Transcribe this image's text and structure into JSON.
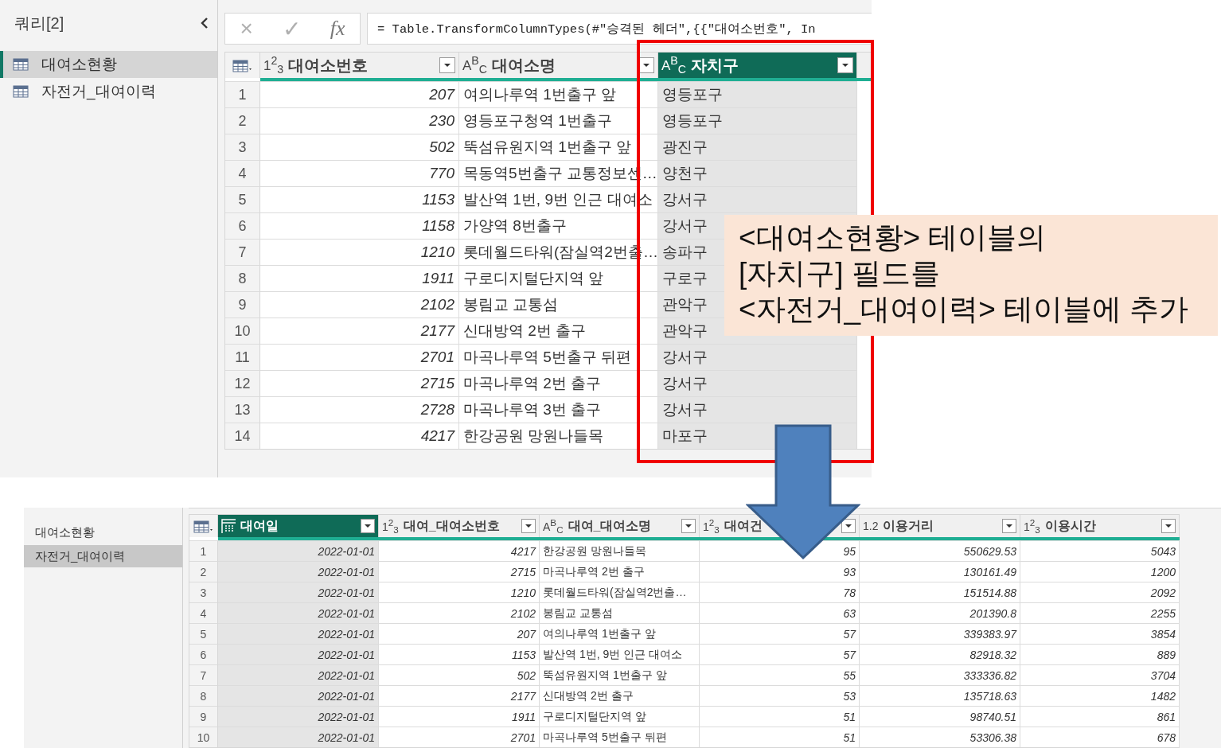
{
  "top_panel": {
    "sidebar": {
      "title": "쿼리[2]",
      "items": [
        {
          "label": "대여소현황",
          "selected": true
        },
        {
          "label": "자전거_대여이력",
          "selected": false
        }
      ]
    },
    "formula_bar": {
      "cancel": "×",
      "commit": "✓",
      "fx": "fx",
      "formula": "= Table.TransformColumnTypes(#\"승격된 헤더\",{{\"대여소번호\", In"
    },
    "table": {
      "columns": [
        {
          "label": "대여소번호",
          "kind": "number",
          "type_label": "1$^{2}$$_{3}$",
          "selected": false
        },
        {
          "label": "대여소명",
          "kind": "text",
          "type_label": "A$^{B}$$_{C}$",
          "selected": false
        },
        {
          "label": "자치구",
          "kind": "text",
          "type_label": "A$^{B}$$_{C}$",
          "selected": true
        }
      ],
      "rows": [
        {
          "index": "1",
          "cells": [
            "207",
            "여의나루역 1번출구 앞",
            "영등포구"
          ]
        },
        {
          "index": "2",
          "cells": [
            "230",
            "영등포구청역 1번출구",
            "영등포구"
          ]
        },
        {
          "index": "3",
          "cells": [
            "502",
            "뚝섬유원지역 1번출구 앞",
            "광진구"
          ]
        },
        {
          "index": "4",
          "cells": [
            "770",
            "목동역5번출구 교통정보센…",
            "양천구"
          ]
        },
        {
          "index": "5",
          "cells": [
            "1153",
            "발산역 1번, 9번 인근 대여소",
            "강서구"
          ]
        },
        {
          "index": "6",
          "cells": [
            "1158",
            "가양역 8번출구",
            "강서구"
          ]
        },
        {
          "index": "7",
          "cells": [
            "1210",
            "롯데월드타워(잠실역2번출…",
            "송파구"
          ]
        },
        {
          "index": "8",
          "cells": [
            "1911",
            "구로디지털단지역 앞",
            "구로구"
          ]
        },
        {
          "index": "9",
          "cells": [
            "2102",
            "봉림교 교통섬",
            "관악구"
          ]
        },
        {
          "index": "10",
          "cells": [
            "2177",
            "신대방역 2번 출구",
            "관악구"
          ]
        },
        {
          "index": "11",
          "cells": [
            "2701",
            "마곡나루역 5번출구 뒤편",
            "강서구"
          ]
        },
        {
          "index": "12",
          "cells": [
            "2715",
            "마곡나루역 2번 출구",
            "강서구"
          ]
        },
        {
          "index": "13",
          "cells": [
            "2728",
            "마곡나루역 3번 출구",
            "강서구"
          ]
        },
        {
          "index": "14",
          "cells": [
            "4217",
            "한강공원 망원나들목",
            "마포구"
          ]
        }
      ]
    }
  },
  "bottom_panel": {
    "sidebar": {
      "items": [
        {
          "label": "대여소현황",
          "selected": false
        },
        {
          "label": "자전거_대여이력",
          "selected": true
        }
      ]
    },
    "table": {
      "columns": [
        {
          "label": "대여일",
          "kind": "date",
          "selected": true
        },
        {
          "label": "대여_대여소번호",
          "kind": "number",
          "type_label": "1$^{2}$$_{3}$",
          "selected": false
        },
        {
          "label": "대여_대여소명",
          "kind": "text",
          "type_label": "A$^{B}$$_{C}$",
          "selected": false
        },
        {
          "label": "대여건",
          "kind": "number",
          "type_label": "1$^{2}$$_{3}$",
          "selected": false
        },
        {
          "label": "이용거리",
          "kind": "number",
          "type_label": "1.2",
          "selected": false
        },
        {
          "label": "이용시간",
          "kind": "number",
          "type_label": "1$^{2}$$_{3}$",
          "selected": false
        }
      ],
      "rows": [
        {
          "index": "1",
          "cells": [
            "2022-01-01",
            "4217",
            "한강공원 망원나들목",
            "95",
            "550629.53",
            "5043"
          ]
        },
        {
          "index": "2",
          "cells": [
            "2022-01-01",
            "2715",
            "마곡나루역 2번 출구",
            "93",
            "130161.49",
            "1200"
          ]
        },
        {
          "index": "3",
          "cells": [
            "2022-01-01",
            "1210",
            "롯데월드타워(잠실역2번출…",
            "78",
            "151514.88",
            "2092"
          ]
        },
        {
          "index": "4",
          "cells": [
            "2022-01-01",
            "2102",
            "봉림교 교통섬",
            "63",
            "201390.8",
            "2255"
          ]
        },
        {
          "index": "5",
          "cells": [
            "2022-01-01",
            "207",
            "여의나루역 1번출구 앞",
            "57",
            "339383.97",
            "3854"
          ]
        },
        {
          "index": "6",
          "cells": [
            "2022-01-01",
            "1153",
            "발산역 1번, 9번 인근 대여소",
            "57",
            "82918.32",
            "889"
          ]
        },
        {
          "index": "7",
          "cells": [
            "2022-01-01",
            "502",
            "뚝섬유원지역 1번출구 앞",
            "55",
            "333336.82",
            "3704"
          ]
        },
        {
          "index": "8",
          "cells": [
            "2022-01-01",
            "2177",
            "신대방역 2번 출구",
            "53",
            "135718.63",
            "1482"
          ]
        },
        {
          "index": "9",
          "cells": [
            "2022-01-01",
            "1911",
            "구로디지털단지역 앞",
            "51",
            "98740.51",
            "861"
          ]
        },
        {
          "index": "10",
          "cells": [
            "2022-01-01",
            "2701",
            "마곡나루역 5번출구 뒤편",
            "51",
            "53306.38",
            "678"
          ]
        }
      ]
    }
  },
  "annotation": {
    "text": "<대여소현황> 테이블의\n[자치구] 필드를\n<자전거_대여이력> 테이블에 추가"
  }
}
